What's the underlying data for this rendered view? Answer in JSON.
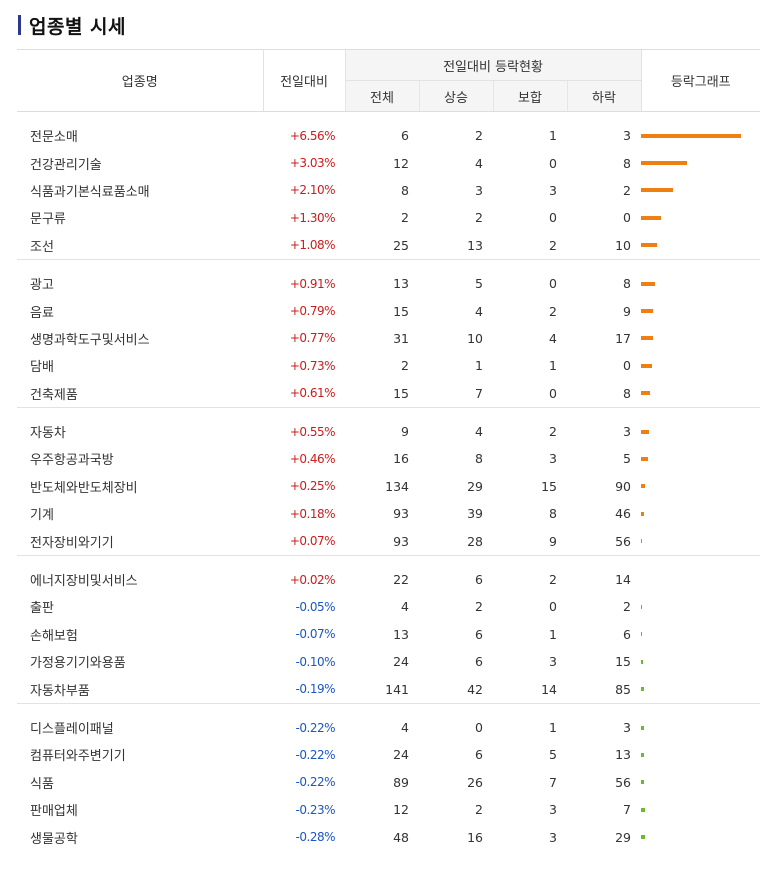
{
  "title": "업종별 시세",
  "headers": {
    "name": "업종명",
    "change": "전일대비",
    "group": "전일대비 등락현황",
    "total": "전체",
    "rise": "상승",
    "flat": "보합",
    "fall": "하락",
    "graph": "등락그래프"
  },
  "groups": [
    [
      {
        "name": "전문소매",
        "rate": "+6.56%",
        "dir": "up",
        "total": "6",
        "rise": "2",
        "flat": "1",
        "fall": "3",
        "bar_pct": 6.56
      },
      {
        "name": "건강관리기술",
        "rate": "+3.03%",
        "dir": "up",
        "total": "12",
        "rise": "4",
        "flat": "0",
        "fall": "8",
        "bar_pct": 3.03
      },
      {
        "name": "식품과기본식료품소매",
        "rate": "+2.10%",
        "dir": "up",
        "total": "8",
        "rise": "3",
        "flat": "3",
        "fall": "2",
        "bar_pct": 2.1
      },
      {
        "name": "문구류",
        "rate": "+1.30%",
        "dir": "up",
        "total": "2",
        "rise": "2",
        "flat": "0",
        "fall": "0",
        "bar_pct": 1.3
      },
      {
        "name": "조선",
        "rate": "+1.08%",
        "dir": "up",
        "total": "25",
        "rise": "13",
        "flat": "2",
        "fall": "10",
        "bar_pct": 1.08
      }
    ],
    [
      {
        "name": "광고",
        "rate": "+0.91%",
        "dir": "up",
        "total": "13",
        "rise": "5",
        "flat": "0",
        "fall": "8",
        "bar_pct": 0.91
      },
      {
        "name": "음료",
        "rate": "+0.79%",
        "dir": "up",
        "total": "15",
        "rise": "4",
        "flat": "2",
        "fall": "9",
        "bar_pct": 0.79
      },
      {
        "name": "생명과학도구및서비스",
        "rate": "+0.77%",
        "dir": "up",
        "total": "31",
        "rise": "10",
        "flat": "4",
        "fall": "17",
        "bar_pct": 0.77
      },
      {
        "name": "담배",
        "rate": "+0.73%",
        "dir": "up",
        "total": "2",
        "rise": "1",
        "flat": "1",
        "fall": "0",
        "bar_pct": 0.73
      },
      {
        "name": "건축제품",
        "rate": "+0.61%",
        "dir": "up",
        "total": "15",
        "rise": "7",
        "flat": "0",
        "fall": "8",
        "bar_pct": 0.61
      }
    ],
    [
      {
        "name": "자동차",
        "rate": "+0.55%",
        "dir": "up",
        "total": "9",
        "rise": "4",
        "flat": "2",
        "fall": "3",
        "bar_pct": 0.55
      },
      {
        "name": "우주항공과국방",
        "rate": "+0.46%",
        "dir": "up",
        "total": "16",
        "rise": "8",
        "flat": "3",
        "fall": "5",
        "bar_pct": 0.46
      },
      {
        "name": "반도체와반도체장비",
        "rate": "+0.25%",
        "dir": "up",
        "total": "134",
        "rise": "29",
        "flat": "15",
        "fall": "90",
        "bar_pct": 0.25
      },
      {
        "name": "기계",
        "rate": "+0.18%",
        "dir": "up",
        "total": "93",
        "rise": "39",
        "flat": "8",
        "fall": "46",
        "bar_pct": 0.18
      },
      {
        "name": "전자장비와기기",
        "rate": "+0.07%",
        "dir": "up",
        "total": "93",
        "rise": "28",
        "flat": "9",
        "fall": "56",
        "bar_pct": 0.07
      }
    ],
    [
      {
        "name": "에너지장비및서비스",
        "rate": "+0.02%",
        "dir": "up",
        "total": "22",
        "rise": "6",
        "flat": "2",
        "fall": "14",
        "bar_pct": 0.02
      },
      {
        "name": "출판",
        "rate": "-0.05%",
        "dir": "dn",
        "total": "4",
        "rise": "2",
        "flat": "0",
        "fall": "2",
        "bar_pct": 0.05
      },
      {
        "name": "손해보험",
        "rate": "-0.07%",
        "dir": "dn",
        "total": "13",
        "rise": "6",
        "flat": "1",
        "fall": "6",
        "bar_pct": 0.07
      },
      {
        "name": "가정용기기와용품",
        "rate": "-0.10%",
        "dir": "dn",
        "total": "24",
        "rise": "6",
        "flat": "3",
        "fall": "15",
        "bar_pct": 0.1
      },
      {
        "name": "자동차부품",
        "rate": "-0.19%",
        "dir": "dn",
        "total": "141",
        "rise": "42",
        "flat": "14",
        "fall": "85",
        "bar_pct": 0.19
      }
    ],
    [
      {
        "name": "디스플레이패널",
        "rate": "-0.22%",
        "dir": "dn",
        "total": "4",
        "rise": "0",
        "flat": "1",
        "fall": "3",
        "bar_pct": 0.22
      },
      {
        "name": "컴퓨터와주변기기",
        "rate": "-0.22%",
        "dir": "dn",
        "total": "24",
        "rise": "6",
        "flat": "5",
        "fall": "13",
        "bar_pct": 0.22
      },
      {
        "name": "식품",
        "rate": "-0.22%",
        "dir": "dn",
        "total": "89",
        "rise": "26",
        "flat": "7",
        "fall": "56",
        "bar_pct": 0.22
      },
      {
        "name": "판매업체",
        "rate": "-0.23%",
        "dir": "dn",
        "total": "12",
        "rise": "2",
        "flat": "3",
        "fall": "7",
        "bar_pct": 0.23
      },
      {
        "name": "생물공학",
        "rate": "-0.28%",
        "dir": "dn",
        "total": "48",
        "rise": "16",
        "flat": "3",
        "fall": "29",
        "bar_pct": 0.28
      }
    ]
  ],
  "colors": {
    "up_text": "#cc1c1c",
    "down_text": "#1b56c7",
    "up_bar": "#f07f13",
    "down_bar": "#6cba2f"
  }
}
